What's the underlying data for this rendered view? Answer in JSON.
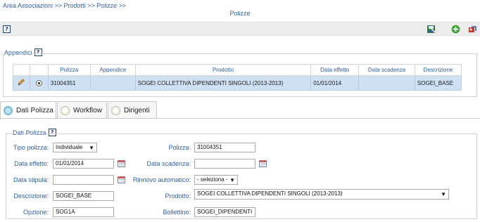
{
  "breadcrumb": "Area Associazioni >> Prodotti >> Polizze >>",
  "page_title": "Polizze",
  "toolbar": {
    "help": "?"
  },
  "appendici": {
    "legend": "Appendici",
    "help": "?",
    "columns": [
      "Polizza",
      "Appendice",
      "Prodotto",
      "Data effetto",
      "Data scadenza",
      "Descrizione"
    ],
    "rows": [
      {
        "polizza": "31004351",
        "appendice": "",
        "prodotto": "SOGEI COLLETTIVA DIPENDENTI SINGOLI (2013-2013)",
        "data_effetto": "01/01/2014",
        "data_scadenza": "",
        "descrizione": "SOGEI_BASE"
      }
    ]
  },
  "tabs": [
    {
      "label": "Dati Polizza",
      "active": true
    },
    {
      "label": "Workflow",
      "active": false
    },
    {
      "label": "Dirigenti",
      "active": false
    }
  ],
  "dati_polizza": {
    "legend": "Dati Polizza",
    "help": "?",
    "tipo_polizza": {
      "label": "Tipo polizza:",
      "value": "Individuale"
    },
    "polizza": {
      "label": "Polizza:",
      "value": "31004351"
    },
    "data_effetto": {
      "label": "Data effetto:",
      "value": "01/01/2014"
    },
    "data_scadenza": {
      "label": "Data scadenza:",
      "value": ""
    },
    "data_stipula": {
      "label": "Data stipula:",
      "value": ""
    },
    "rinnovo": {
      "label": "Rinnovo automatico:",
      "value": "- seleziona -"
    },
    "descrizione": {
      "label": "Descrizione:",
      "value": "SOGEI_BASE"
    },
    "prodotto": {
      "label": "Prodotto:",
      "value": "SOGEI COLLETTIVA DIPENDENTI SINGOLI (2013-2013)"
    },
    "opzione": {
      "label": "Opzione:",
      "value": "SOG1A"
    },
    "bollettino": {
      "label": "Bollettino:",
      "value": "SOGEI_DIPENDENTI"
    }
  },
  "colors": {
    "link": "#2d5fa0",
    "row_selected": "#cfe0f3",
    "toolbar": "#ececec"
  },
  "icons": [
    "help-icon",
    "save-icon",
    "add-icon",
    "exit-icon",
    "edit-icon",
    "calendar-icon"
  ]
}
